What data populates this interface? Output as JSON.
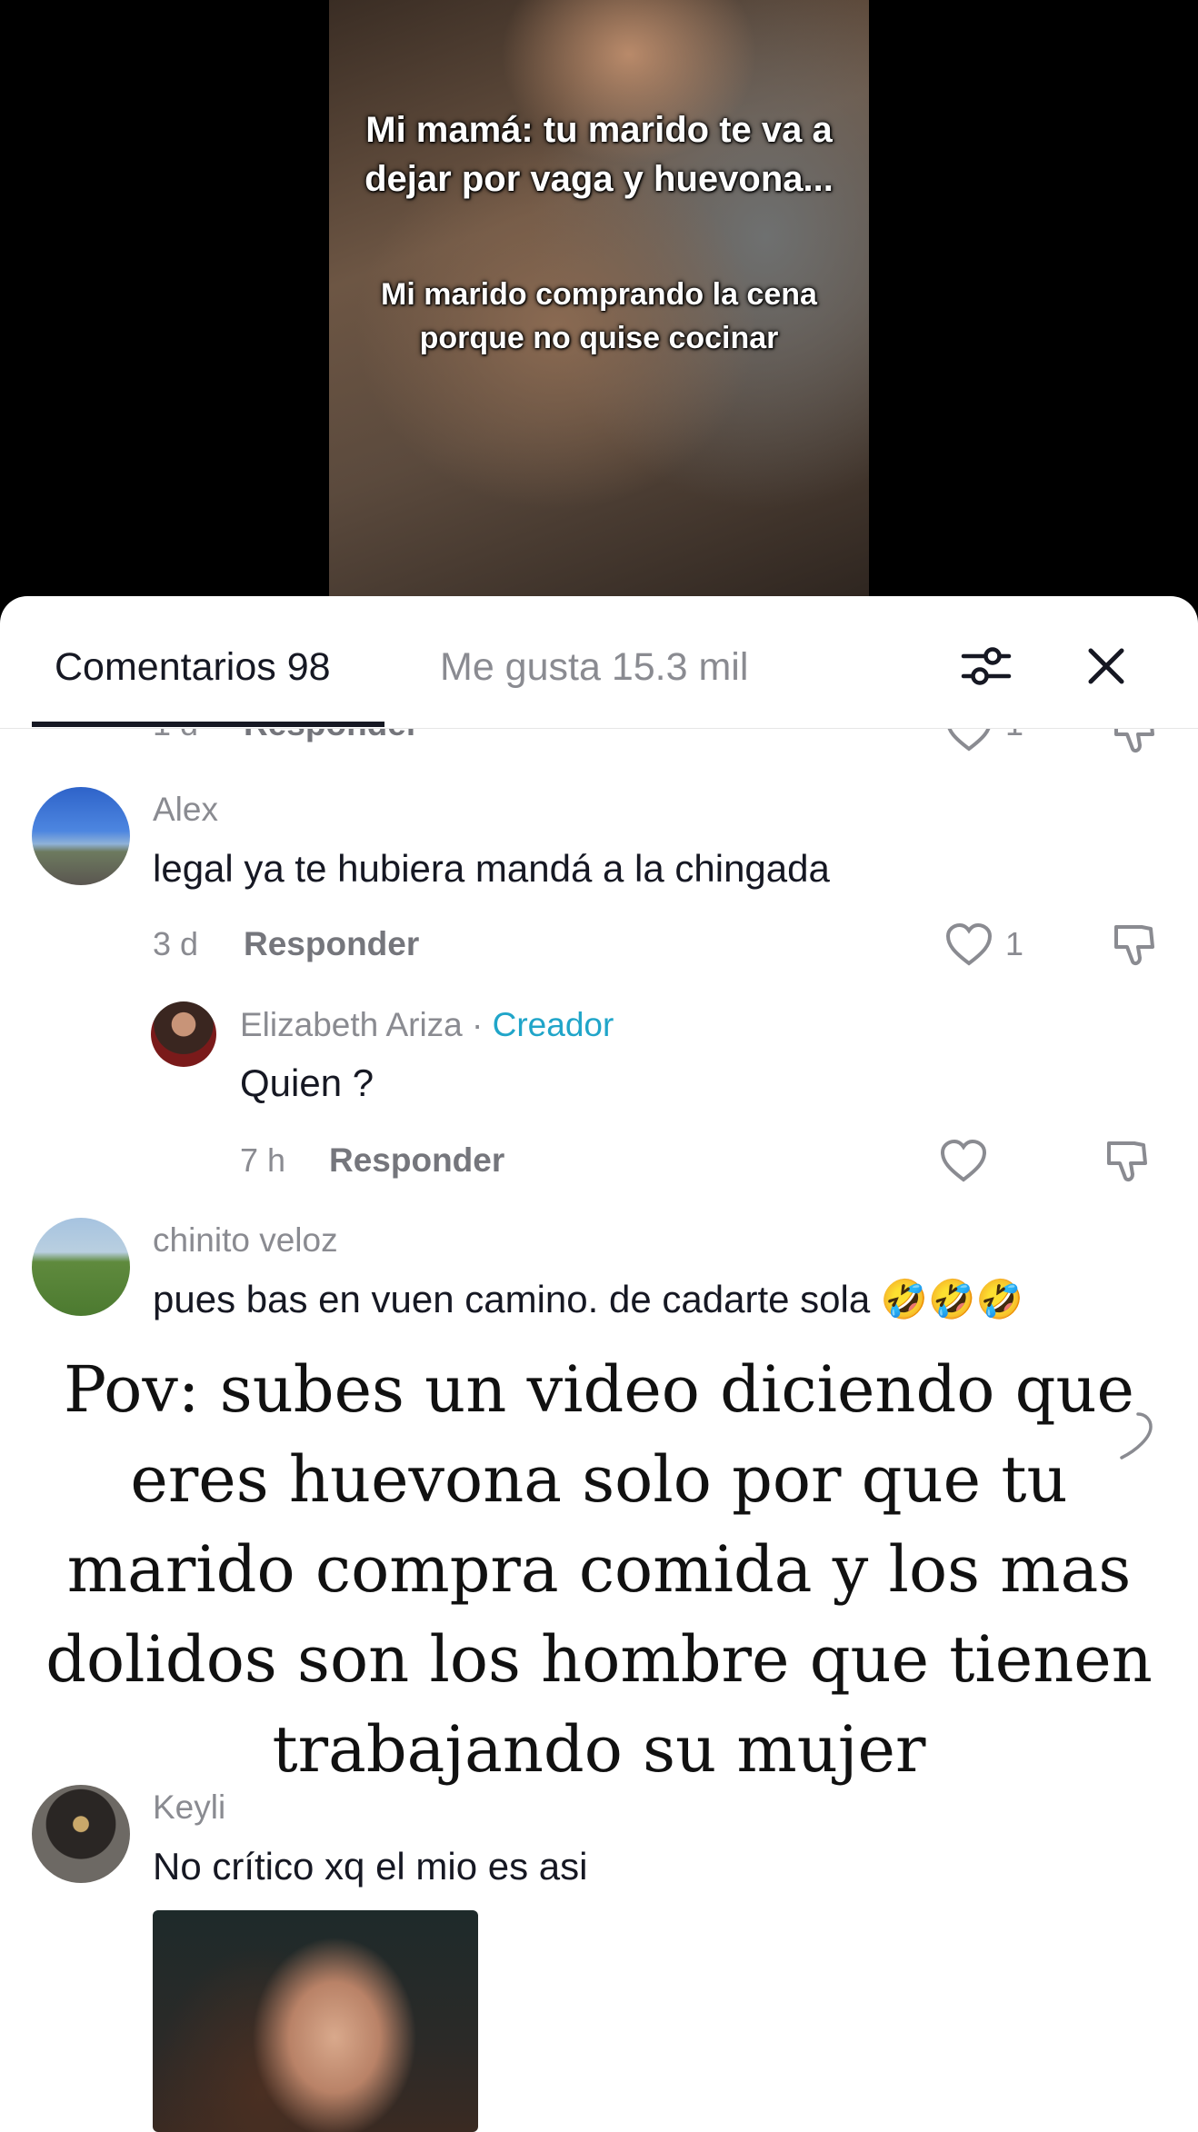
{
  "video": {
    "caption_top": "Mi mamá: tu marido te va a dejar por vaga y huevona...",
    "caption_bottom": "Mi marido comprando la cena porque no quise cocinar"
  },
  "tabs": {
    "comments": "Comentarios 98",
    "likes": "Me gusta 15.3 mil",
    "filter_icon": "filter-sliders-icon",
    "close_icon": "close-icon"
  },
  "partial_row": {
    "time": "1 d",
    "reply": "Responder",
    "likes": "1"
  },
  "comments": [
    {
      "user": "Alex",
      "text": "legal ya te hubiera mandá a la chingada",
      "time": "3 d",
      "reply": "Responder",
      "likes": "1"
    },
    {
      "user": "Elizabeth Ariza",
      "separator": " · ",
      "badge": "Creador",
      "text": "Quien ?",
      "time": "7 h",
      "reply": "Responder"
    },
    {
      "user": "chinito veloz",
      "text": "pues bas en vuen camino. de cadarte sola 🤣🤣🤣"
    },
    {
      "user": "Keyli",
      "text": "No crítico xq el mio es asi"
    }
  ],
  "overlay": {
    "lines": [
      "Pov: subes un video diciendo que",
      "eres huevona solo por que tu",
      "marido compra comida y los mas",
      "dolidos son los hombre que tienen",
      "trabajando su mujer"
    ]
  },
  "colors": {
    "accent_creator": "#20a5c9",
    "text_primary": "#161823",
    "text_secondary": "#8a8b91"
  }
}
